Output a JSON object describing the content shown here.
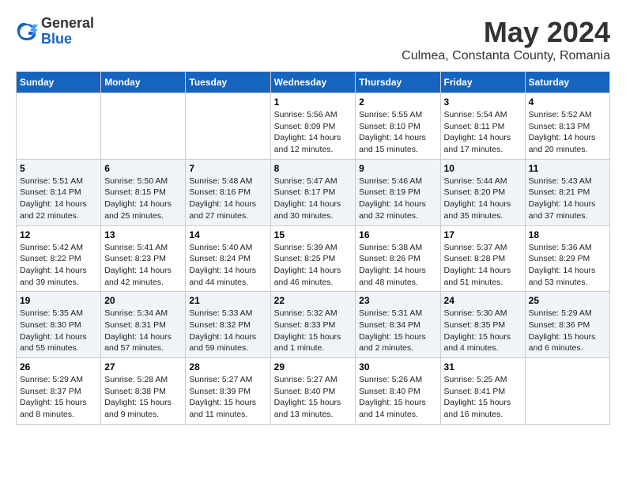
{
  "header": {
    "logo_general": "General",
    "logo_blue": "Blue",
    "month": "May 2024",
    "location": "Culmea, Constanta County, Romania"
  },
  "weekdays": [
    "Sunday",
    "Monday",
    "Tuesday",
    "Wednesday",
    "Thursday",
    "Friday",
    "Saturday"
  ],
  "weeks": [
    [
      {
        "day": "",
        "info": ""
      },
      {
        "day": "",
        "info": ""
      },
      {
        "day": "",
        "info": ""
      },
      {
        "day": "1",
        "info": "Sunrise: 5:56 AM\nSunset: 8:09 PM\nDaylight: 14 hours\nand 12 minutes."
      },
      {
        "day": "2",
        "info": "Sunrise: 5:55 AM\nSunset: 8:10 PM\nDaylight: 14 hours\nand 15 minutes."
      },
      {
        "day": "3",
        "info": "Sunrise: 5:54 AM\nSunset: 8:11 PM\nDaylight: 14 hours\nand 17 minutes."
      },
      {
        "day": "4",
        "info": "Sunrise: 5:52 AM\nSunset: 8:13 PM\nDaylight: 14 hours\nand 20 minutes."
      }
    ],
    [
      {
        "day": "5",
        "info": "Sunrise: 5:51 AM\nSunset: 8:14 PM\nDaylight: 14 hours\nand 22 minutes."
      },
      {
        "day": "6",
        "info": "Sunrise: 5:50 AM\nSunset: 8:15 PM\nDaylight: 14 hours\nand 25 minutes."
      },
      {
        "day": "7",
        "info": "Sunrise: 5:48 AM\nSunset: 8:16 PM\nDaylight: 14 hours\nand 27 minutes."
      },
      {
        "day": "8",
        "info": "Sunrise: 5:47 AM\nSunset: 8:17 PM\nDaylight: 14 hours\nand 30 minutes."
      },
      {
        "day": "9",
        "info": "Sunrise: 5:46 AM\nSunset: 8:19 PM\nDaylight: 14 hours\nand 32 minutes."
      },
      {
        "day": "10",
        "info": "Sunrise: 5:44 AM\nSunset: 8:20 PM\nDaylight: 14 hours\nand 35 minutes."
      },
      {
        "day": "11",
        "info": "Sunrise: 5:43 AM\nSunset: 8:21 PM\nDaylight: 14 hours\nand 37 minutes."
      }
    ],
    [
      {
        "day": "12",
        "info": "Sunrise: 5:42 AM\nSunset: 8:22 PM\nDaylight: 14 hours\nand 39 minutes."
      },
      {
        "day": "13",
        "info": "Sunrise: 5:41 AM\nSunset: 8:23 PM\nDaylight: 14 hours\nand 42 minutes."
      },
      {
        "day": "14",
        "info": "Sunrise: 5:40 AM\nSunset: 8:24 PM\nDaylight: 14 hours\nand 44 minutes."
      },
      {
        "day": "15",
        "info": "Sunrise: 5:39 AM\nSunset: 8:25 PM\nDaylight: 14 hours\nand 46 minutes."
      },
      {
        "day": "16",
        "info": "Sunrise: 5:38 AM\nSunset: 8:26 PM\nDaylight: 14 hours\nand 48 minutes."
      },
      {
        "day": "17",
        "info": "Sunrise: 5:37 AM\nSunset: 8:28 PM\nDaylight: 14 hours\nand 51 minutes."
      },
      {
        "day": "18",
        "info": "Sunrise: 5:36 AM\nSunset: 8:29 PM\nDaylight: 14 hours\nand 53 minutes."
      }
    ],
    [
      {
        "day": "19",
        "info": "Sunrise: 5:35 AM\nSunset: 8:30 PM\nDaylight: 14 hours\nand 55 minutes."
      },
      {
        "day": "20",
        "info": "Sunrise: 5:34 AM\nSunset: 8:31 PM\nDaylight: 14 hours\nand 57 minutes."
      },
      {
        "day": "21",
        "info": "Sunrise: 5:33 AM\nSunset: 8:32 PM\nDaylight: 14 hours\nand 59 minutes."
      },
      {
        "day": "22",
        "info": "Sunrise: 5:32 AM\nSunset: 8:33 PM\nDaylight: 15 hours\nand 1 minute."
      },
      {
        "day": "23",
        "info": "Sunrise: 5:31 AM\nSunset: 8:34 PM\nDaylight: 15 hours\nand 2 minutes."
      },
      {
        "day": "24",
        "info": "Sunrise: 5:30 AM\nSunset: 8:35 PM\nDaylight: 15 hours\nand 4 minutes."
      },
      {
        "day": "25",
        "info": "Sunrise: 5:29 AM\nSunset: 8:36 PM\nDaylight: 15 hours\nand 6 minutes."
      }
    ],
    [
      {
        "day": "26",
        "info": "Sunrise: 5:29 AM\nSunset: 8:37 PM\nDaylight: 15 hours\nand 8 minutes."
      },
      {
        "day": "27",
        "info": "Sunrise: 5:28 AM\nSunset: 8:38 PM\nDaylight: 15 hours\nand 9 minutes."
      },
      {
        "day": "28",
        "info": "Sunrise: 5:27 AM\nSunset: 8:39 PM\nDaylight: 15 hours\nand 11 minutes."
      },
      {
        "day": "29",
        "info": "Sunrise: 5:27 AM\nSunset: 8:40 PM\nDaylight: 15 hours\nand 13 minutes."
      },
      {
        "day": "30",
        "info": "Sunrise: 5:26 AM\nSunset: 8:40 PM\nDaylight: 15 hours\nand 14 minutes."
      },
      {
        "day": "31",
        "info": "Sunrise: 5:25 AM\nSunset: 8:41 PM\nDaylight: 15 hours\nand 16 minutes."
      },
      {
        "day": "",
        "info": ""
      }
    ]
  ]
}
